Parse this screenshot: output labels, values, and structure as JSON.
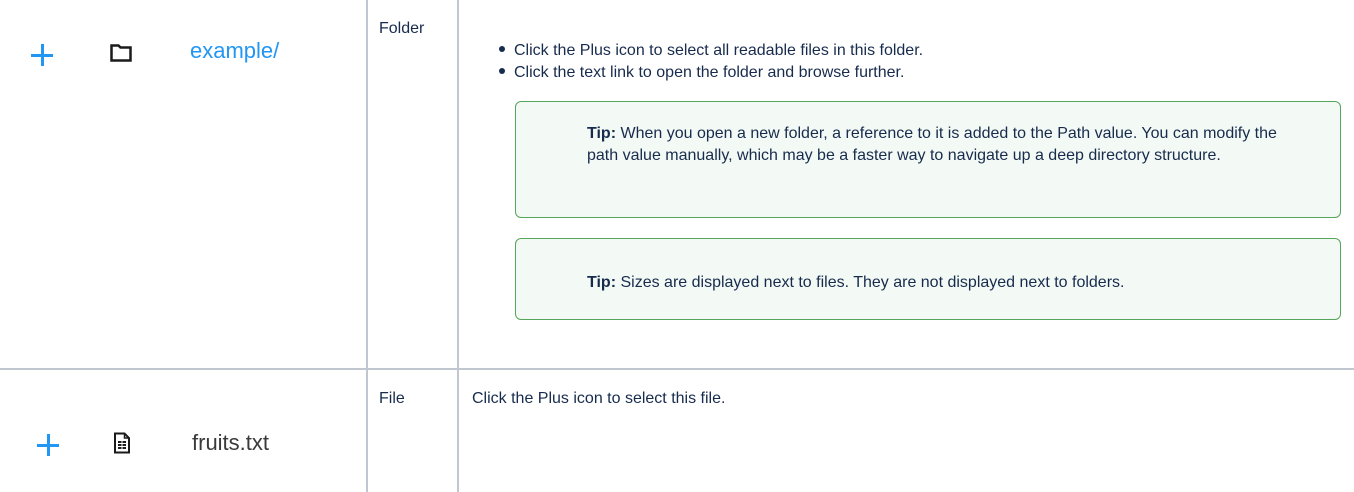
{
  "rows": [
    {
      "name": "example/",
      "type": "Folder",
      "bullets": [
        "Click the Plus icon to select all readable files in this folder.",
        "Click the text link to open the folder and browse further."
      ],
      "tips": [
        {
          "label": "Tip:",
          "text": " When you open a new folder, a reference to it is added to the Path value. You can modify the path value manually, which may be a faster way to navigate up a deep directory structure."
        },
        {
          "label": "Tip:",
          "text": " Sizes are displayed next to files. They are not displayed next to folders."
        }
      ]
    },
    {
      "name": "fruits.txt",
      "type": "File",
      "description": "Click the Plus icon to select this file."
    }
  ],
  "icons": {
    "plus": "plus-icon",
    "folder": "folder-icon",
    "file": "file-text-icon"
  },
  "colors": {
    "link_blue": "#2196f3",
    "tip_border": "#57a55a",
    "tip_background": "#f3f9f4",
    "table_border": "#c1c7d0"
  }
}
